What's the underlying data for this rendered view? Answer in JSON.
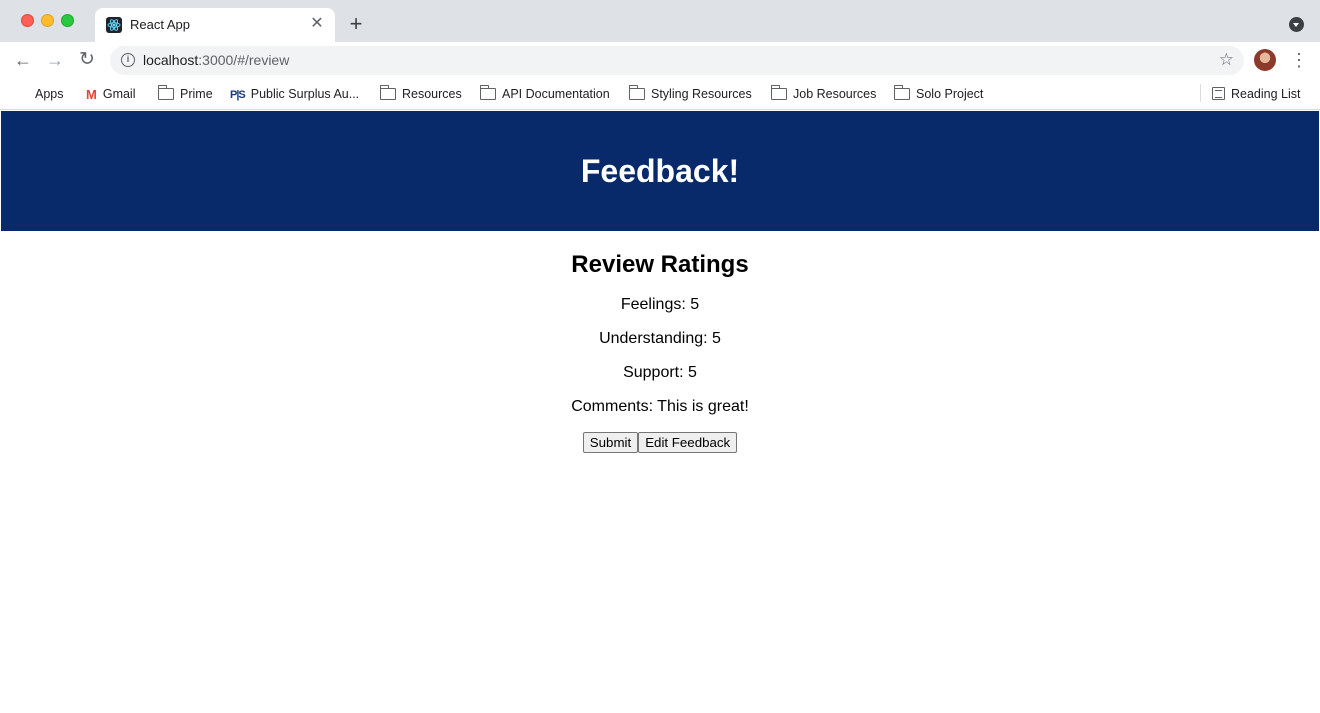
{
  "browser": {
    "tab_title": "React App",
    "tab_close": "✕",
    "new_tab": "+",
    "url_host": "localhost",
    "url_path": ":3000/#/review",
    "back": "←",
    "forward": "→",
    "reload": "↻",
    "star": "☆",
    "menu": "⋮"
  },
  "bookmarks": {
    "apps": "Apps",
    "gmail": "Gmail",
    "prime": "Prime",
    "public_surplus": "Public Surplus Au...",
    "resources": "Resources",
    "api_docs": "API Documentation",
    "styling": "Styling Resources",
    "jobs": "Job Resources",
    "solo": "Solo Project",
    "reading_list": "Reading List"
  },
  "header": {
    "title": "Feedback!"
  },
  "review": {
    "heading": "Review Ratings",
    "feelings": "Feelings: 5",
    "understanding": "Understanding: 5",
    "support": "Support: 5",
    "comments": "Comments: This is great!",
    "submit_label": "Submit",
    "edit_label": "Edit Feedback"
  },
  "colors": {
    "header_bg": "#082a6b",
    "header_text": "#ffffff"
  }
}
